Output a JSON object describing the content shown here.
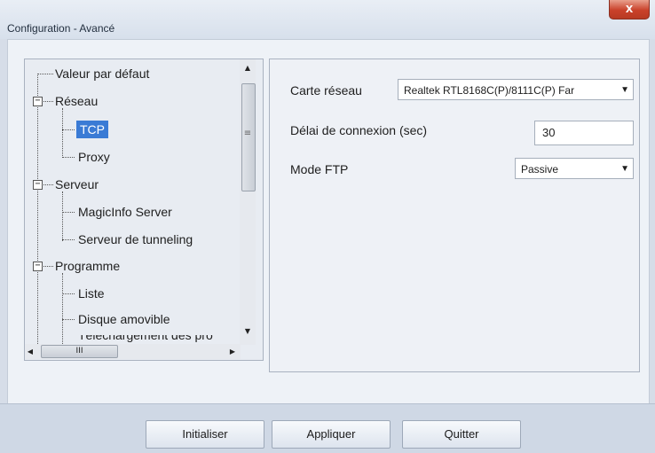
{
  "window": {
    "title": "Configuration - Avancé",
    "close_label": "x"
  },
  "tree": {
    "items": [
      {
        "label": "Valeur par défaut"
      },
      {
        "label": "Réseau",
        "expander": "−"
      },
      {
        "label": "TCP"
      },
      {
        "label": "Proxy"
      },
      {
        "label": "Serveur",
        "expander": "−"
      },
      {
        "label": "MagicInfo Server"
      },
      {
        "label": "Serveur de tunneling"
      },
      {
        "label": "Programme",
        "expander": "−"
      },
      {
        "label": "Liste"
      },
      {
        "label": "Disque amovible"
      },
      {
        "label": "Téléchargement des pro"
      }
    ],
    "selected": "TCP",
    "grip": "≡",
    "h_grip": "III"
  },
  "settings": {
    "network_card": {
      "label": "Carte réseau",
      "value": "Realtek RTL8168C(P)/8111C(P) Far"
    },
    "timeout": {
      "label": "Délai de connexion (sec)",
      "value": "30"
    },
    "ftp_mode": {
      "label": "Mode FTP",
      "value": "Passive"
    }
  },
  "buttons": {
    "initialize": "Initialiser",
    "apply": "Appliquer",
    "quit": "Quitter"
  },
  "colors": {
    "selection": "#3a7bd5",
    "close": "#c9412a"
  }
}
